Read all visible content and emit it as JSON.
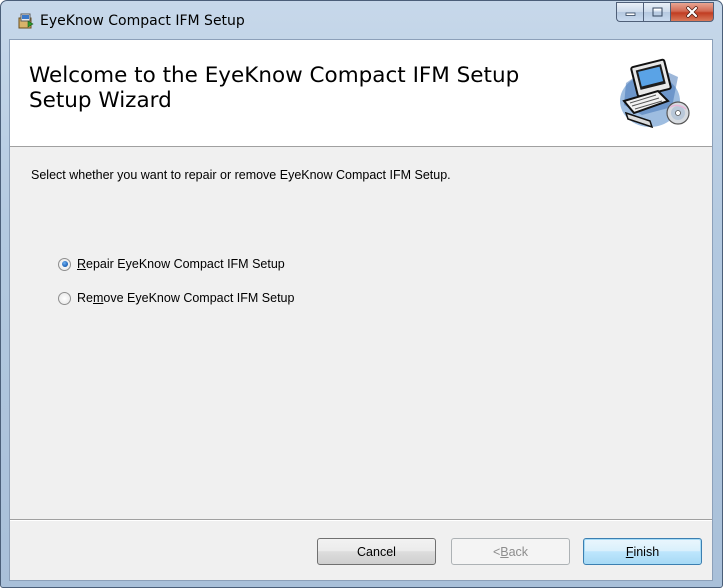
{
  "window": {
    "title": "EyeKnow Compact IFM Setup"
  },
  "banner": {
    "title_line1": "Welcome to the EyeKnow Compact IFM Setup",
    "title_line2": "Setup Wizard",
    "image_icon": "computer-cd-icon"
  },
  "instruction": "Select whether you want to repair or remove EyeKnow Compact IFM Setup.",
  "options": [
    {
      "accel": "R",
      "rest": "epair EyeKnow Compact IFM Setup",
      "checked": true
    },
    {
      "pre": "Re",
      "accel": "m",
      "rest": "ove EyeKnow Compact IFM Setup",
      "checked": false
    }
  ],
  "buttons": {
    "cancel": "Cancel",
    "back_prefix": "< ",
    "back_accel": "B",
    "back_rest": "ack",
    "finish_accel": "F",
    "finish_rest": "inish"
  }
}
